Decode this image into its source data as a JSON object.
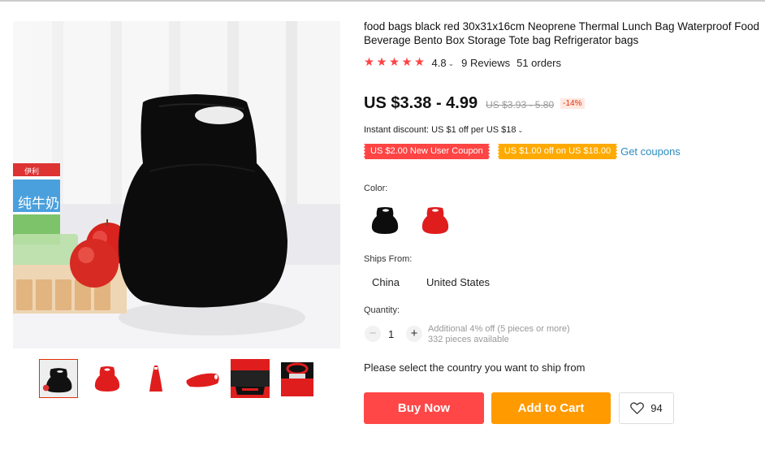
{
  "product": {
    "title": "food bags black red 30x31x16cm Neoprene Thermal Lunch Bag Waterproof Food Beverage Bento Box Storage Tote bag Refrigerator bags",
    "rating": "4.8",
    "reviews": "9 Reviews",
    "orders": "51 orders",
    "price": "US $3.38 - 4.99",
    "old_price": "US $3.93 - 5.80",
    "discount": "-14%",
    "instant_discount": "Instant discount: US $1 off per US $18",
    "coupons": [
      "US $2.00 New User Coupon",
      "US $1.00 off on US $18.00"
    ],
    "get_coupons": "Get coupons",
    "rating_stars": 4.8
  },
  "image": {
    "milk_carton_text": "纯牛奶",
    "milk_brand": "伊利"
  },
  "options": {
    "color_label": "Color:",
    "colors": [
      "black",
      "red"
    ],
    "ships_from_label": "Ships From:",
    "ships_from": [
      "China",
      "United States"
    ],
    "quantity_label": "Quantity:",
    "quantity": "1",
    "qty_minus": "−",
    "qty_plus": "+",
    "qty_note_1": "Additional 4% off (5 pieces or more)",
    "qty_note_2": "332 pieces available"
  },
  "messages": {
    "select_country": "Please select the country you want to ship from"
  },
  "actions": {
    "buy_now": "Buy Now",
    "add_to_cart": "Add to Cart",
    "wishlist_count": "94"
  },
  "colors": {
    "accent_red": "#ff4747",
    "accent_orange": "#ff9a00",
    "link_blue": "#2b8bbf",
    "star": "#ff4444"
  }
}
